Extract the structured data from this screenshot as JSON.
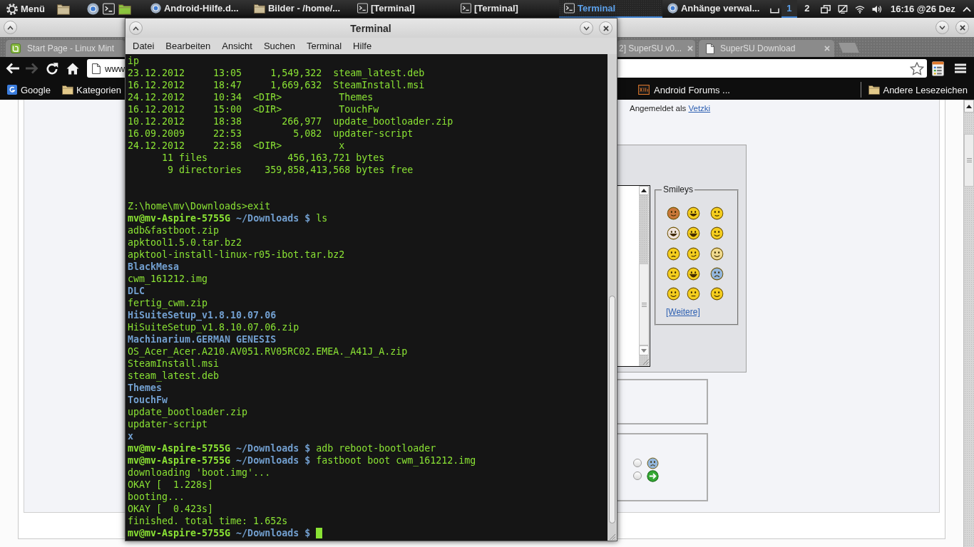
{
  "panel": {
    "menu_label": "Menü",
    "tasks": [
      {
        "label": "Android-Hilfe.d...",
        "kind": "browser",
        "selected": false
      },
      {
        "label": "Bilder - /home/...",
        "kind": "folder",
        "selected": false
      },
      {
        "label": "[Terminal]",
        "kind": "terminal",
        "selected": false
      },
      {
        "label": "[Terminal]",
        "kind": "terminal",
        "selected": false
      },
      {
        "label": "Terminal",
        "kind": "terminal",
        "selected": true
      },
      {
        "label": "Anhänge verwal...",
        "kind": "browser",
        "selected": false
      }
    ],
    "workspaces": [
      {
        "label": "1",
        "selected": true
      },
      {
        "label": "2",
        "selected": false
      }
    ],
    "clock": "16:16 @26 Dez"
  },
  "browser": {
    "tabs": [
      {
        "title": "Start Page - Linux Mint",
        "kind": "logo",
        "selected": false
      },
      {
        "title": "2] SuperSU v0...",
        "kind": "plain",
        "selected": false
      },
      {
        "title": "SuperSU Download",
        "kind": "page",
        "selected": false
      }
    ],
    "nav_buttons": [
      {
        "kind": "back",
        "disabled": false
      },
      {
        "kind": "forward",
        "disabled": true
      },
      {
        "kind": "reload",
        "disabled": false
      },
      {
        "kind": "home",
        "disabled": false
      }
    ],
    "address": "www",
    "bookmarks": [
      {
        "label": "Google",
        "kind": "logo"
      },
      {
        "label": "Kategorien",
        "kind": "folder"
      },
      {
        "label": "Android Forums ...",
        "kind": "forum"
      }
    ],
    "other_bookmarks": "Andere Lesezeichen"
  },
  "page": {
    "login": {
      "label": "Angemeldet als",
      "user": "Vetzki"
    },
    "smileys_legend": "Smileys",
    "more_smileys": "[Weitere]",
    "post_icons": [
      {
        "kind": "sad",
        "selected": false
      },
      {
        "kind": "arrow",
        "selected": false
      }
    ]
  },
  "terminal": {
    "title": "Terminal",
    "menu": [
      "Datei",
      "Bearbeiten",
      "Ansicht",
      "Suchen",
      "Terminal",
      "Hilfe"
    ],
    "lines": [
      {
        "kind": "output",
        "text": "ip"
      },
      {
        "kind": "output",
        "text": "23.12.2012     13:05     1,549,322  steam_latest.deb"
      },
      {
        "kind": "output",
        "text": "16.12.2012     18:47     1,669,632  SteamInstall.msi"
      },
      {
        "kind": "output",
        "text": "24.12.2012     10:34  <DIR>          Themes"
      },
      {
        "kind": "output",
        "text": "16.12.2012     15:00  <DIR>          TouchFw"
      },
      {
        "kind": "output",
        "text": "10.12.2012     18:38       266,977  update_bootloader.zip"
      },
      {
        "kind": "output",
        "text": "16.09.2009     22:53         5,082  updater-script"
      },
      {
        "kind": "output",
        "text": "24.12.2012     22:58  <DIR>          x"
      },
      {
        "kind": "output",
        "text": "      11 files              456,163,721 bytes"
      },
      {
        "kind": "output",
        "text": "       9 directories    359,858,413,568 bytes free"
      },
      {
        "kind": "blank"
      },
      {
        "kind": "blank"
      },
      {
        "kind": "output",
        "text": "Z:\\home\\mv\\Downloads>exit"
      },
      {
        "kind": "prompt",
        "user": "mv@mv-Aspire-5755G",
        "path": "~/Downloads $",
        "command": "ls",
        "cursor": false
      },
      {
        "kind": "output",
        "text": "adb&fastboot.zip"
      },
      {
        "kind": "output",
        "text": "apktool1.5.0.tar.bz2"
      },
      {
        "kind": "output",
        "text": "apktool-install-linux-r05-ibot.tar.bz2"
      },
      {
        "kind": "directory",
        "text": "BlackMesa"
      },
      {
        "kind": "output",
        "text": "cwm_161212.img"
      },
      {
        "kind": "directory",
        "text": "DLC"
      },
      {
        "kind": "output",
        "text": "fertig_cwm.zip"
      },
      {
        "kind": "directory",
        "text": "HiSuiteSetup_v1.8.10.07.06"
      },
      {
        "kind": "output",
        "text": "HiSuiteSetup_v1.8.10.07.06.zip"
      },
      {
        "kind": "directory",
        "text": "Machinarium.GERMAN GENESIS"
      },
      {
        "kind": "output",
        "text": "OS_Acer_Acer.A210.AV051.RV05RC02.EMEA._A41J_A.zip"
      },
      {
        "kind": "output",
        "text": "SteamInstall.msi"
      },
      {
        "kind": "output",
        "text": "steam_latest.deb"
      },
      {
        "kind": "directory",
        "text": "Themes"
      },
      {
        "kind": "directory",
        "text": "TouchFw"
      },
      {
        "kind": "output",
        "text": "update_bootloader.zip"
      },
      {
        "kind": "output",
        "text": "updater-script"
      },
      {
        "kind": "directory",
        "text": "x"
      },
      {
        "kind": "prompt",
        "user": "mv@mv-Aspire-5755G",
        "path": "~/Downloads $",
        "command": "adb reboot-bootloader",
        "cursor": false
      },
      {
        "kind": "prompt",
        "user": "mv@mv-Aspire-5755G",
        "path": "~/Downloads $",
        "command": "fastboot boot cwm_161212.img",
        "cursor": false
      },
      {
        "kind": "output",
        "text": "downloading 'boot.img'..."
      },
      {
        "kind": "output",
        "text": "OKAY [  1.228s]"
      },
      {
        "kind": "output",
        "text": "booting..."
      },
      {
        "kind": "output",
        "text": "OKAY [  0.423s]"
      },
      {
        "kind": "output",
        "text": "finished. total time: 1.652s"
      },
      {
        "kind": "prompt",
        "user": "mv@mv-Aspire-5755G",
        "path": "~/Downloads $",
        "cursor": true
      }
    ]
  }
}
